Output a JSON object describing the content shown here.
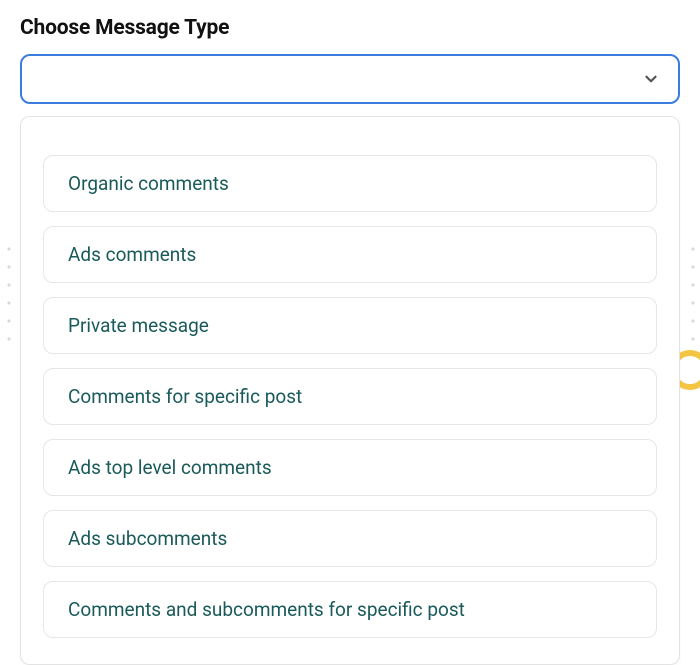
{
  "label": "Choose Message Type",
  "selected_value": "",
  "options": [
    "Organic comments",
    "Ads comments",
    "Private message",
    "Comments for specific post",
    "Ads top level comments",
    "Ads subcomments",
    "Comments and subcomments for specific post"
  ]
}
